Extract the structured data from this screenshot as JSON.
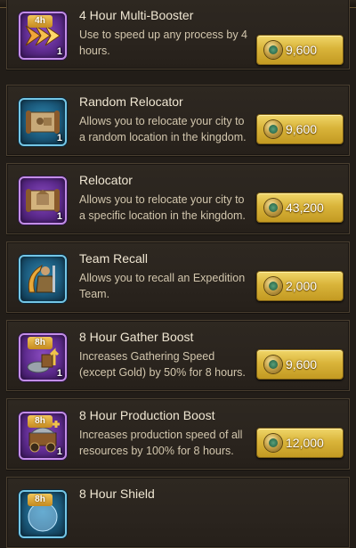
{
  "items": [
    {
      "title": "4 Hour Multi-Booster",
      "desc_lines": [
        "Use to speed up any process by 4",
        "hours."
      ],
      "badge": "4h",
      "qty": "1",
      "price": "9,600",
      "icon": "multi-booster-arrows-icon",
      "frame": "purple"
    },
    {
      "title": "Random Relocator",
      "desc_lines": [
        "Allows you to relocate your city to",
        "a random location in the kingdom."
      ],
      "badge": "",
      "qty": "1",
      "price": "9,600",
      "icon": "random-relocator-scroll-icon",
      "frame": "blue"
    },
    {
      "title": "Relocator",
      "desc_lines": [
        "Allows you to relocate your city to",
        "a specific location in the kingdom."
      ],
      "badge": "",
      "qty": "1",
      "price": "43,200",
      "icon": "relocator-scroll-icon",
      "frame": "purple"
    },
    {
      "title": "Team Recall",
      "desc_lines": [
        "Allows you to recall an Expedition",
        "Team."
      ],
      "badge": "",
      "qty": "",
      "price": "2,000",
      "icon": "team-recall-warrior-icon",
      "frame": "blue"
    },
    {
      "title": "8 Hour Gather Boost",
      "desc_lines": [
        "Increases Gathering Speed",
        "(except Gold) by 50% for 8 hours."
      ],
      "badge": "8h",
      "qty": "1",
      "price": "9,600",
      "icon": "gather-boost-resources-icon",
      "frame": "purple"
    },
    {
      "title": "8 Hour Production Boost",
      "desc_lines": [
        "Increases production speed of all",
        "resources by 100% for 8 hours."
      ],
      "badge": "8h",
      "qty": "1",
      "price": "12,000",
      "icon": "production-boost-cart-icon",
      "frame": "purple"
    },
    {
      "title": "8 Hour Shield",
      "desc_lines": [
        "",
        ""
      ],
      "badge": "8h",
      "qty": "",
      "price": "",
      "icon": "shield-bubble-icon",
      "frame": "blue"
    }
  ],
  "colors": {
    "gold_button": "#d9b43a",
    "card_bg": "#2a241e",
    "purple_frame": "#c38de8",
    "blue_frame": "#73c6e6"
  }
}
